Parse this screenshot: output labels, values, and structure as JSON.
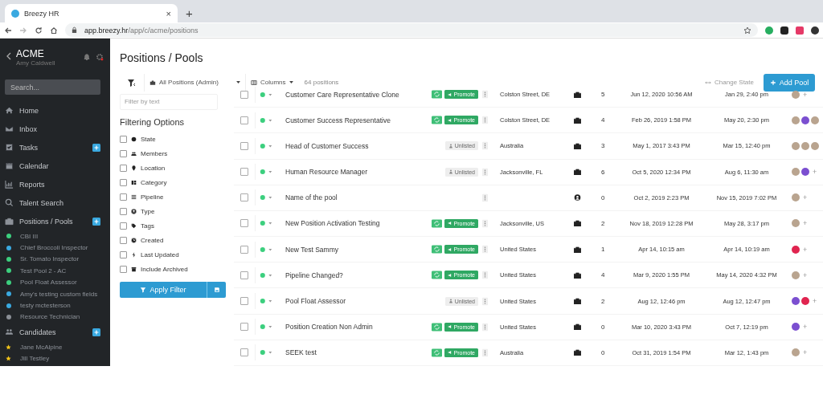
{
  "browser": {
    "tab_title": "Breezy HR",
    "tab_close": "×",
    "new_tab": "+",
    "url_host": "app.breezy.hr",
    "url_path": "/app/c/acme/positions"
  },
  "sidebar": {
    "company": "ACME",
    "user": "Amy Caldwell",
    "search_placeholder": "Search...",
    "nav": [
      {
        "label": "Home",
        "kind": "home",
        "badge": false
      },
      {
        "label": "Inbox",
        "kind": "mail",
        "badge": false
      },
      {
        "label": "Tasks",
        "kind": "check",
        "badge": true
      },
      {
        "label": "Calendar",
        "kind": "calendar",
        "badge": false
      },
      {
        "label": "Reports",
        "kind": "chart",
        "badge": false
      },
      {
        "label": "Talent Search",
        "kind": "search",
        "badge": false
      },
      {
        "label": "Positions / Pools",
        "kind": "briefcase",
        "badge": true,
        "children": [
          {
            "label": "CBI III",
            "kind": "dot",
            "color": "#3ccf7e"
          },
          {
            "label": "Chief Broccoli Inspector",
            "kind": "dot",
            "color": "#3aa9e0"
          },
          {
            "label": "Sr. Tomato Inspector",
            "kind": "dot",
            "color": "#3ccf7e"
          },
          {
            "label": "Test Pool 2 - AC",
            "kind": "dot",
            "color": "#3ccf7e"
          },
          {
            "label": "Pool Float Assessor",
            "kind": "dot",
            "color": "#3ccf7e"
          },
          {
            "label": "Amy's testing custom fields",
            "kind": "dot",
            "color": "#3aa9e0"
          },
          {
            "label": "testy mctesterson",
            "kind": "dot",
            "color": "#3aa9e0"
          },
          {
            "label": "Resource Technician",
            "kind": "dot",
            "color": "#8a8f96"
          }
        ]
      },
      {
        "label": "Candidates",
        "kind": "people",
        "badge": true,
        "children": [
          {
            "label": "Jane McAlpine",
            "kind": "star"
          },
          {
            "label": "Jill Testley",
            "kind": "star"
          }
        ]
      }
    ]
  },
  "page": {
    "title": "Positions / Pools"
  },
  "toolbar": {
    "scope": "All Positions (Admin)",
    "columns": "Columns",
    "count": "64 positions",
    "change_state": "Change State",
    "add": "Add Pool"
  },
  "filters": {
    "placeholder": "Filter by text",
    "heading": "Filtering Options",
    "apply": "Apply Filter",
    "options": [
      {
        "label": "State",
        "kind": "circle",
        "checked": false
      },
      {
        "label": "Members",
        "kind": "people",
        "checked": false
      },
      {
        "label": "Location",
        "kind": "pin",
        "checked": false
      },
      {
        "label": "Category",
        "kind": "grid",
        "checked": false
      },
      {
        "label": "Pipeline",
        "kind": "list",
        "checked": false
      },
      {
        "label": "Type",
        "kind": "user",
        "checked": false
      },
      {
        "label": "Tags",
        "kind": "tag",
        "checked": false
      },
      {
        "label": "Created",
        "kind": "clock",
        "checked": false
      },
      {
        "label": "Last Updated",
        "kind": "bolt",
        "checked": false
      },
      {
        "label": "Include Archived",
        "kind": "archive",
        "checked": false
      }
    ]
  },
  "table": {
    "rows": [
      {
        "selected": false,
        "name": "Customer Care Representative Clone",
        "badge": {
          "kind": "promote",
          "label": "Promote"
        },
        "location": "Colston Street, DE",
        "type": {
          "kind": "briefcase"
        },
        "count": "5",
        "created": "Jun 12, 2020 10:56 AM",
        "updated": "Jan 29, 2:40 pm",
        "avatars": [
          {
            "kind": "photo"
          }
        ],
        "add": "+"
      },
      {
        "selected": false,
        "name": "Customer Success Representative",
        "badge": {
          "kind": "promote",
          "label": "Promote"
        },
        "location": "Colston Street, DE",
        "type": {
          "kind": "briefcase"
        },
        "count": "4",
        "created": "Feb 26, 2019 1:58 PM",
        "updated": "May 20, 2:30 pm",
        "avatars": [
          {
            "kind": "photo"
          },
          {
            "kind": "initial",
            "color": "#7b4fd0"
          },
          {
            "kind": "photo"
          }
        ]
      },
      {
        "selected": false,
        "name": "Head of Customer Success",
        "badge": {
          "kind": "unlisted",
          "label": "Unlisted"
        },
        "location": "Australia",
        "type": {
          "kind": "briefcase"
        },
        "count": "3",
        "created": "May 1, 2017 3:43 PM",
        "updated": "Mar 15, 12:40 pm",
        "avatars": [
          {
            "kind": "photo"
          },
          {
            "kind": "photo"
          },
          {
            "kind": "photo"
          }
        ]
      },
      {
        "selected": false,
        "name": "Human Resource Manager",
        "badge": {
          "kind": "unlisted",
          "label": "Unlisted"
        },
        "location": "Jacksonville, FL",
        "type": {
          "kind": "briefcase"
        },
        "count": "6",
        "created": "Oct 5, 2020 12:34 PM",
        "updated": "Aug 6, 11:30 am",
        "avatars": [
          {
            "kind": "photo"
          },
          {
            "kind": "initial",
            "color": "#7b4fd0"
          }
        ],
        "add": "+"
      },
      {
        "selected": false,
        "name": "Name of the pool",
        "location": "",
        "type": {
          "kind": "user"
        },
        "count": "0",
        "created": "Oct 2, 2019 2:23 PM",
        "updated": "Nov 15, 2019 7:02 PM",
        "avatars": [
          {
            "kind": "photo"
          }
        ],
        "add": "+"
      },
      {
        "selected": false,
        "name": "New Position Activation Testing",
        "badge": {
          "kind": "promote",
          "label": "Promote"
        },
        "location": "Jacksonville, US",
        "type": {
          "kind": "briefcase"
        },
        "count": "2",
        "created": "Nov 18, 2019 12:28 PM",
        "updated": "May 28, 3:17 pm",
        "avatars": [
          {
            "kind": "photo"
          }
        ],
        "add": "+"
      },
      {
        "selected": false,
        "name": "New Test Sammy",
        "badge": {
          "kind": "promote",
          "label": "Promote"
        },
        "location": "United States",
        "type": {
          "kind": "briefcase"
        },
        "count": "1",
        "created": "Apr 14, 10:15 am",
        "updated": "Apr 14, 10:19 am",
        "avatars": [
          {
            "kind": "initial",
            "color": "#e0244f"
          }
        ],
        "add": "+"
      },
      {
        "selected": false,
        "name": "Pipeline Changed?",
        "badge": {
          "kind": "promote",
          "label": "Promote"
        },
        "location": "United States",
        "type": {
          "kind": "briefcase"
        },
        "count": "4",
        "created": "Mar 9, 2020 1:55 PM",
        "updated": "May 14, 2020 4:32 PM",
        "avatars": [
          {
            "kind": "photo"
          }
        ],
        "add": "+"
      },
      {
        "selected": false,
        "name": "Pool Float Assessor",
        "badge": {
          "kind": "unlisted",
          "label": "Unlisted"
        },
        "location": "United States",
        "type": {
          "kind": "briefcase"
        },
        "count": "2",
        "created": "Aug 12, 12:46 pm",
        "updated": "Aug 12, 12:47 pm",
        "avatars": [
          {
            "kind": "initial",
            "color": "#7b4fd0"
          },
          {
            "kind": "initial",
            "color": "#e0244f"
          }
        ],
        "add": "+"
      },
      {
        "selected": false,
        "name": "Position Creation Non Admin",
        "badge": {
          "kind": "promote",
          "label": "Promote"
        },
        "location": "United States",
        "type": {
          "kind": "briefcase"
        },
        "count": "0",
        "created": "Mar 10, 2020 3:43 PM",
        "updated": "Oct 7, 12:19 pm",
        "avatars": [
          {
            "kind": "initial",
            "color": "#7b4fd0"
          }
        ],
        "add": "+"
      },
      {
        "selected": false,
        "name": "SEEK test",
        "badge": {
          "kind": "promote",
          "label": "Promote"
        },
        "location": "Australia",
        "type": {
          "kind": "briefcase"
        },
        "count": "0",
        "created": "Oct 31, 2019 1:54 PM",
        "updated": "Mar 12, 1:43 pm",
        "avatars": [
          {
            "kind": "photo"
          }
        ],
        "add": "+"
      }
    ]
  }
}
